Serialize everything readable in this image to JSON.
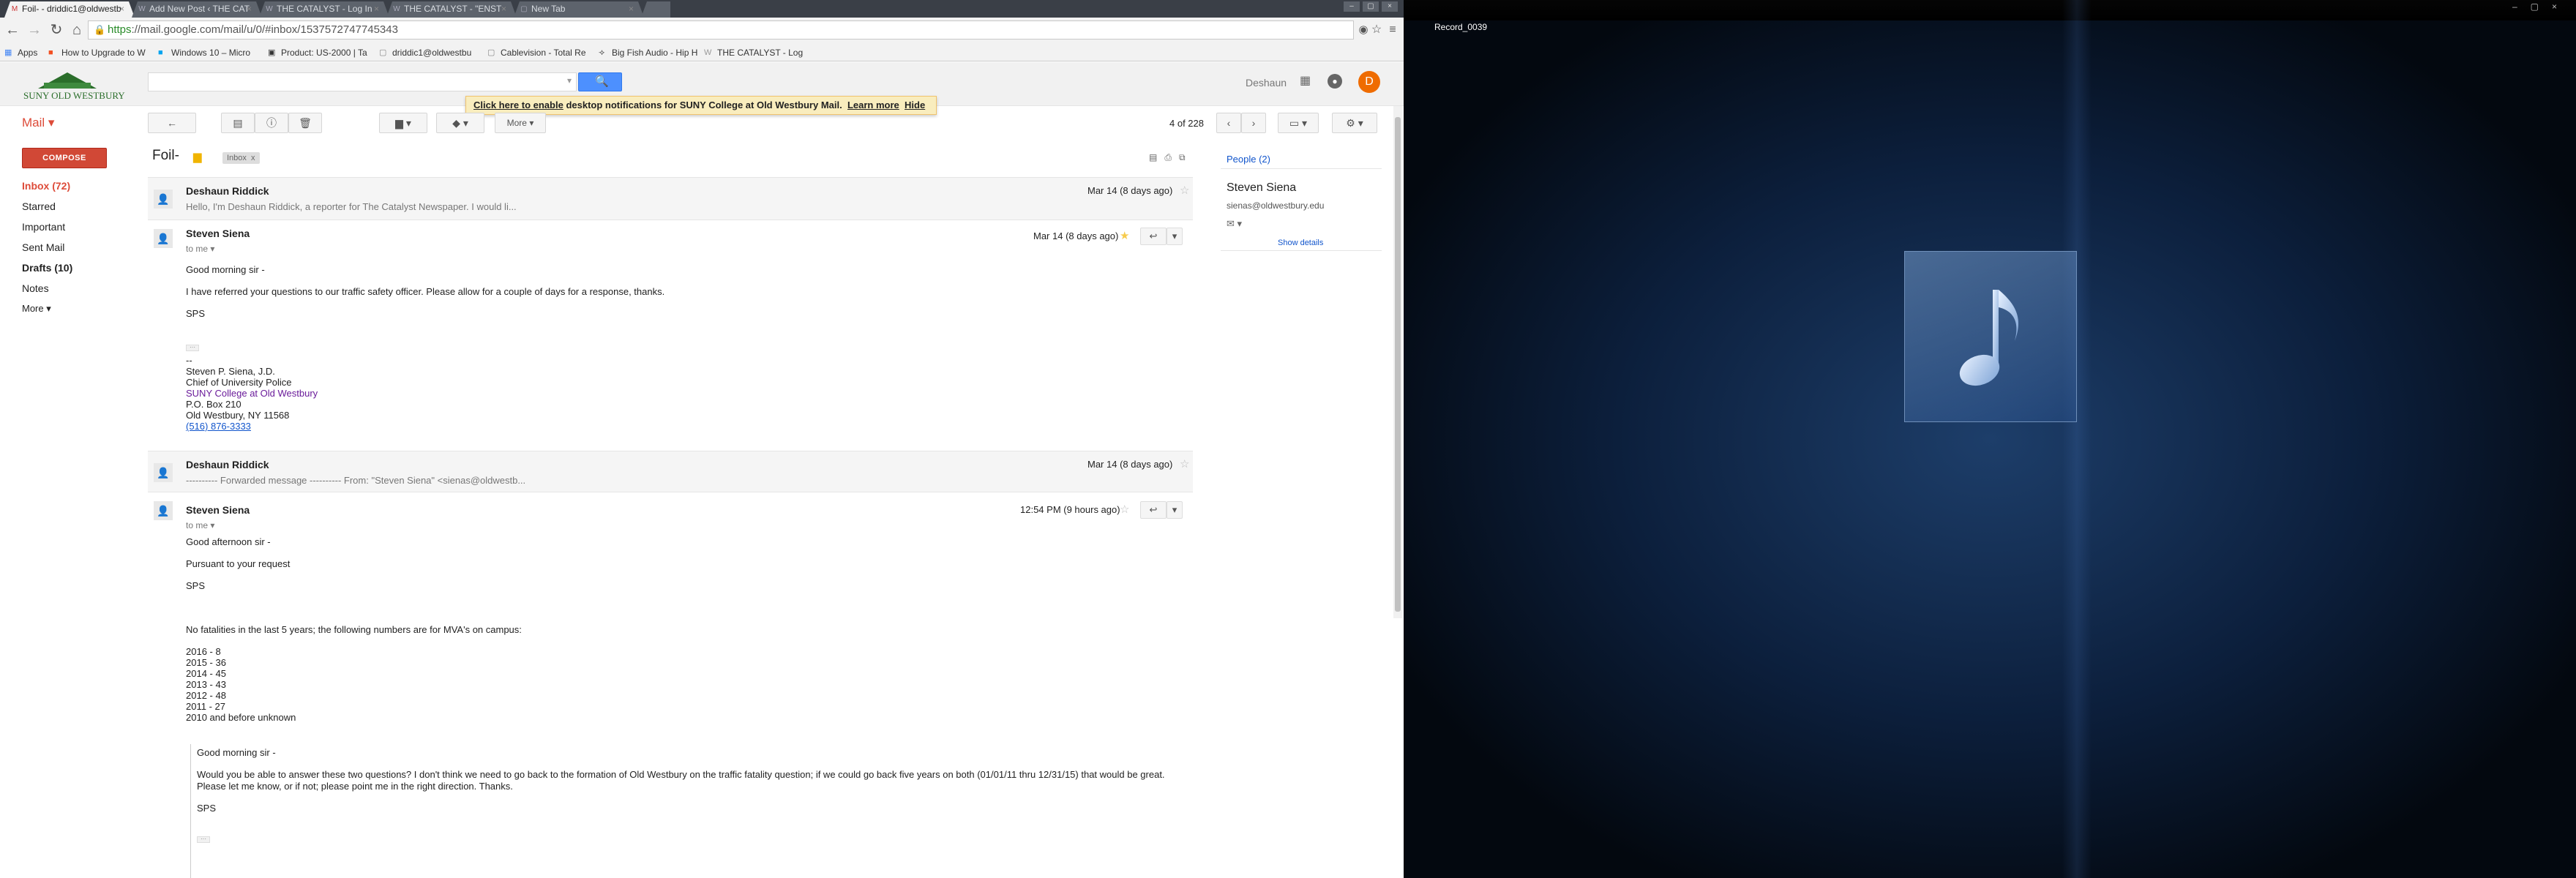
{
  "browser": {
    "tabs": [
      {
        "label": "Foil- - driddic1@oldwestb",
        "active": true
      },
      {
        "label": "Add New Post ‹ THE CAT"
      },
      {
        "label": "THE CATALYST - Log In"
      },
      {
        "label": "THE CATALYST - \"ENST"
      },
      {
        "label": "New Tab"
      }
    ],
    "url": "https://mail.google.com/mail/u/0/#inbox/1537572747745343",
    "url_https": "https",
    "url_rest": "://mail.google.com/mail/u/0/#inbox/1537572747745343"
  },
  "bookmarks": [
    "Apps",
    "How to Upgrade to W",
    "Windows 10 – Micro",
    "Product: US-2000 | Ta",
    "driddic1@oldwestbu",
    "Cablevision - Total Re",
    "Big Fish Audio - Hip H",
    "THE CATALYST - Log I"
  ],
  "header": {
    "logo_text": "SUNY OLD WESTBURY",
    "user_name": "Deshaun",
    "avatar_letter": "D"
  },
  "notification": {
    "link": "Click here to enable",
    "text": " desktop notifications for SUNY College at Old Westbury Mail.",
    "learn_more": "Learn more",
    "hide": "Hide"
  },
  "nav": {
    "mail_label": "Mail ▾",
    "compose": "COMPOSE",
    "items": [
      {
        "label": "Inbox (72)"
      },
      {
        "label": "Starred"
      },
      {
        "label": "Important"
      },
      {
        "label": "Sent Mail"
      },
      {
        "label": "Drafts (10)"
      },
      {
        "label": "Notes"
      },
      {
        "label": "More ▾"
      }
    ]
  },
  "toolbar": {
    "more": "More ▾",
    "pager": "4 of 228"
  },
  "thread": {
    "subject": "Foil-",
    "label": "Inbox",
    "label_x": "x"
  },
  "messages": [
    {
      "sender": "Deshaun Riddick",
      "snippet": "Hello, I'm Deshaun Riddick, a reporter for The Catalyst Newspaper. I would li...",
      "date": "Mar 14 (8 days ago)"
    },
    {
      "sender": "Steven Siena",
      "to": "to me",
      "date": "Mar 14 (8 days ago)",
      "lines": [
        "Good morning sir -",
        "I have referred your questions to our traffic safety officer.  Please allow for a couple of days for a response, thanks.",
        "SPS"
      ],
      "sig": {
        "dash": "--",
        "name": "Steven P. Siena, J.D.",
        "title": "Chief of University Police",
        "college": "SUNY College at Old Westbury",
        "box": "P.O. Box 210",
        "city": "Old Westbury, NY  11568",
        "phone": "(516) 876-3333"
      }
    },
    {
      "sender": "Deshaun Riddick",
      "snippet": "---------- Forwarded message ---------- From: \"Steven Siena\" <sienas@oldwestb...",
      "date": "Mar 14 (8 days ago)"
    },
    {
      "sender": "Steven Siena",
      "to": "to me",
      "date": "12:54 PM (9 hours ago)",
      "lines": [
        "Good afternoon sir -",
        "Pursuant to your request",
        "SPS",
        "No fatalities in the last 5 years; the following numbers are for MVA's on campus:"
      ],
      "stats": [
        "2016 - 8",
        "2015 -  36",
        "2014 - 45",
        "2013 - 43",
        "2012 - 48",
        "2011 - 27",
        "2010 and before unknown"
      ],
      "quote": [
        "Good morning sir -",
        "Would you be able to answer these two questions?  I don't think we need to go back to the formation of Old Westbury on the traffic fatality question; if we could go back five years on both (01/01/11 thru 12/31/15) that would be great.",
        "Please let me know, or if not; please point me in the right direction.  Thanks.",
        "SPS"
      ]
    }
  ],
  "people": {
    "header": "People (2)",
    "name": "Steven Siena",
    "email": "sienas@oldwestbury.edu",
    "show_details": "Show details"
  },
  "player": {
    "title": "Record_0039"
  }
}
